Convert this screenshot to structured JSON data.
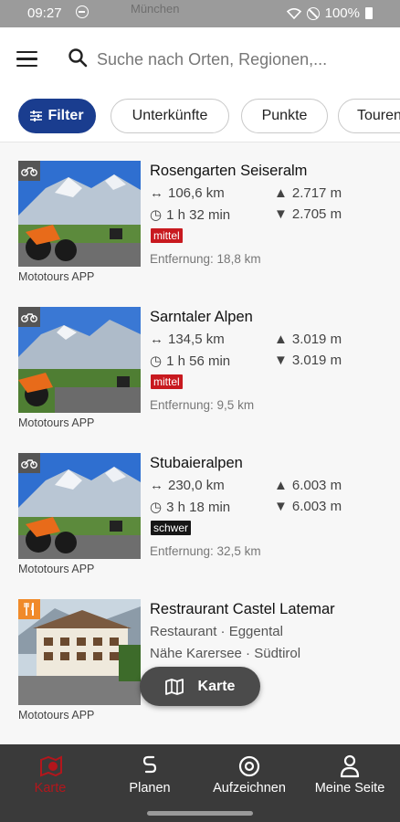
{
  "status_bar": {
    "time": "09:27",
    "map_label": "München",
    "battery": "100%"
  },
  "search": {
    "placeholder": "Suche nach Orten, Regionen,..."
  },
  "chips": {
    "filter": "Filter",
    "items": [
      "Unterkünfte",
      "Punkte",
      "Touren"
    ]
  },
  "items": [
    {
      "title": "Rosengarten Seiseralm",
      "distance": "106,6 km",
      "duration": "1 h 32 min",
      "ascent": "2.717 m",
      "descent": "2.705 m",
      "level": "mittel",
      "entfernung": "Entfernung: 18,8 km",
      "source": "Mototours APP"
    },
    {
      "title": "Sarntaler Alpen",
      "distance": "134,5 km",
      "duration": "1 h 56 min",
      "ascent": "3.019 m",
      "descent": "3.019 m",
      "level": "mittel",
      "entfernung": "Entfernung: 9,5 km",
      "source": "Mototours APP"
    },
    {
      "title": "Stubaieralpen",
      "distance": "230,0 km",
      "duration": "3 h 18 min",
      "ascent": "6.003 m",
      "descent": "6.003 m",
      "level": "schwer",
      "entfernung": "Entfernung: 32,5 km",
      "source": "Mototours APP"
    }
  ],
  "poi": {
    "title": "Restraurant Castel Latemar",
    "category": "Restaurant · Eggental",
    "location": "Nähe Karersee · Südtirol",
    "source": "Mototours APP"
  },
  "fab": {
    "label": "Karte"
  },
  "bottom_nav": [
    {
      "label": "Karte",
      "active": true
    },
    {
      "label": "Planen"
    },
    {
      "label": "Aufzeichnen"
    },
    {
      "label": "Meine Seite"
    }
  ],
  "colors": {
    "accent_blue": "#1a3d8f",
    "mittel": "#c8191f",
    "schwer": "#161616",
    "nav_bg": "#3a3a3a",
    "nav_active": "#b3161c"
  }
}
